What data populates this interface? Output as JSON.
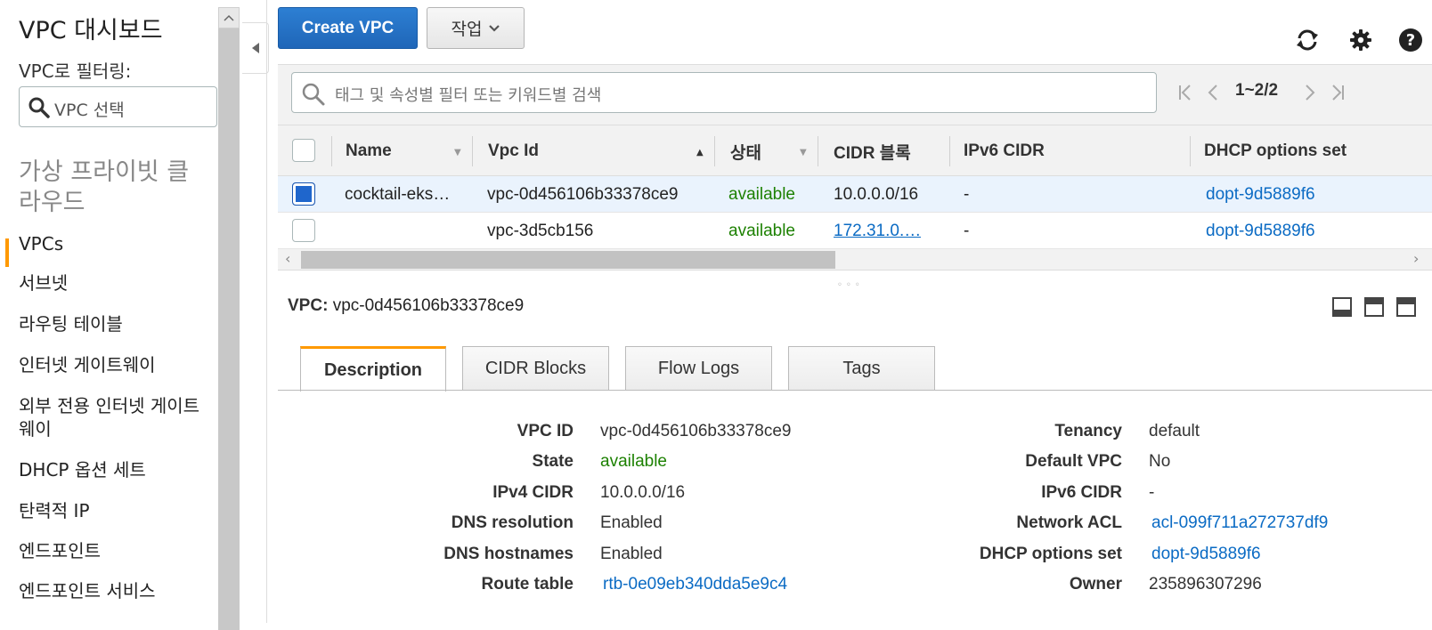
{
  "sidebar": {
    "title": "VPC 대시보드",
    "filter_label": "VPC로 필터링:",
    "vpc_select_placeholder": "VPC 선택",
    "section_title": "가상 프라이빗 클라우드",
    "items": [
      {
        "label": "VPCs",
        "active": true
      },
      {
        "label": "서브넷"
      },
      {
        "label": "라우팅 테이블"
      },
      {
        "label": "인터넷 게이트웨이"
      },
      {
        "label": "외부 전용 인터넷 게이트웨이"
      },
      {
        "label": "DHCP 옵션 세트"
      },
      {
        "label": "탄력적 IP"
      },
      {
        "label": "엔드포인트"
      },
      {
        "label": "엔드포인트 서비스"
      }
    ],
    "active_color": "#ff9900"
  },
  "toolbar": {
    "create_label": "Create VPC",
    "actions_label": "작업",
    "icons": [
      "refresh-icon",
      "gear-icon",
      "help-icon"
    ]
  },
  "filter": {
    "placeholder": "태그 및 속성별 필터 또는 키워드별 검색",
    "pager_text": "1~2/2"
  },
  "table": {
    "columns": [
      "Name",
      "Vpc Id",
      "상태",
      "CIDR 블록",
      "IPv6 CIDR",
      "DHCP options set"
    ],
    "rows": [
      {
        "selected": true,
        "name": "cocktail-eks…",
        "vpc_id": "vpc-0d456106b33378ce9",
        "state": "available",
        "cidr": "10.0.0.0/16",
        "ipv6": "-",
        "dhcp": "dopt-9d5889f6"
      },
      {
        "selected": false,
        "name": "",
        "vpc_id": "vpc-3d5cb156",
        "state": "available",
        "cidr": "172.31.0.…",
        "ipv6": "-",
        "dhcp": "dopt-9d5889f6"
      }
    ]
  },
  "details": {
    "title_label": "VPC:",
    "title_value": "vpc-0d456106b33378ce9",
    "tabs": [
      "Description",
      "CIDR Blocks",
      "Flow Logs",
      "Tags"
    ],
    "left": [
      {
        "label": "VPC ID",
        "value": "vpc-0d456106b33378ce9"
      },
      {
        "label": "State",
        "value": "available"
      },
      {
        "label": "IPv4 CIDR",
        "value": "10.0.0.0/16"
      },
      {
        "label": "DNS resolution",
        "value": "Enabled"
      },
      {
        "label": "DNS hostnames",
        "value": "Enabled"
      },
      {
        "label": "Route table",
        "value": "rtb-0e09eb340dda5e9c4"
      }
    ],
    "right": [
      {
        "label": "Tenancy",
        "value": "default"
      },
      {
        "label": "Default VPC",
        "value": "No"
      },
      {
        "label": "IPv6 CIDR",
        "value": "-"
      },
      {
        "label": "Network ACL",
        "value": "acl-099f711a272737df9"
      },
      {
        "label": "DHCP options set",
        "value": "dopt-9d5889f6"
      },
      {
        "label": "Owner",
        "value": "235896307296"
      }
    ]
  },
  "colors": {
    "primary_button": "#1f66b8",
    "link": "#0b6bc4",
    "status_green": "#1d8102",
    "tab_accent": "#ff9900"
  }
}
